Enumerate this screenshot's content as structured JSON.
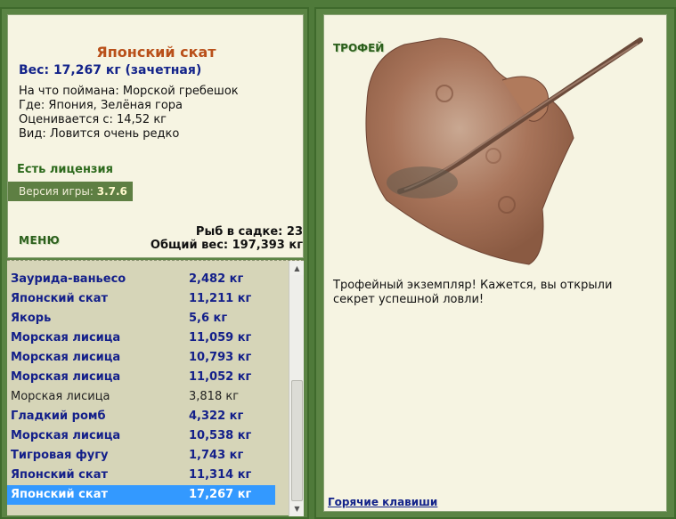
{
  "fish": {
    "name": "Японский скат",
    "weight": "Вес: 17,267 кг (зачетная)",
    "bait": "На что поймана: Морской гребешок",
    "location": "Где: Япония, Зелёная гора",
    "valued_from": "Оценивается с: 14,52 кг",
    "kind": "Вид: Ловится очень редко"
  },
  "license": "Есть лицензия",
  "version": {
    "label": "Версия игры:",
    "value": "3.7.6"
  },
  "menu_label": "МЕНЮ",
  "sadok": {
    "count": "Рыб в садке: 23",
    "total": "Общий вес: 197,393 кг"
  },
  "catch_list": [
    {
      "name": "Заурида-ваньесо",
      "weight": "2,482 кг",
      "style": "bold"
    },
    {
      "name": "Японский скат",
      "weight": "11,211 кг",
      "style": "bold"
    },
    {
      "name": "Якорь",
      "weight": "5,6 кг",
      "style": "bold"
    },
    {
      "name": "Морская лисица",
      "weight": "11,059 кг",
      "style": "bold"
    },
    {
      "name": "Морская лисица",
      "weight": "10,793 кг",
      "style": "bold"
    },
    {
      "name": "Морская лисица",
      "weight": "11,052 кг",
      "style": "bold"
    },
    {
      "name": "Морская лисица",
      "weight": "3,818 кг",
      "style": "normal"
    },
    {
      "name": "Гладкий ромб",
      "weight": "4,322 кг",
      "style": "bold"
    },
    {
      "name": "Морская лисица",
      "weight": "10,538 кг",
      "style": "bold"
    },
    {
      "name": "Тигровая фугу",
      "weight": "1,743 кг",
      "style": "bold"
    },
    {
      "name": "Японский скат",
      "weight": "11,314 кг",
      "style": "bold"
    },
    {
      "name": "Японский скат",
      "weight": "17,267 кг",
      "style": "selected"
    }
  ],
  "trophy": {
    "label": "ТРОФЕЙ",
    "text": "Трофейный экземпляр! Кажется, вы открыли секрет успешной ловли!"
  },
  "hotkeys": "Горячие клавиши",
  "colors": {
    "frame": "#5b8444",
    "panel": "#f6f4e2",
    "title": "#b9501a",
    "link": "#13238a",
    "selected": "#3399ff"
  }
}
